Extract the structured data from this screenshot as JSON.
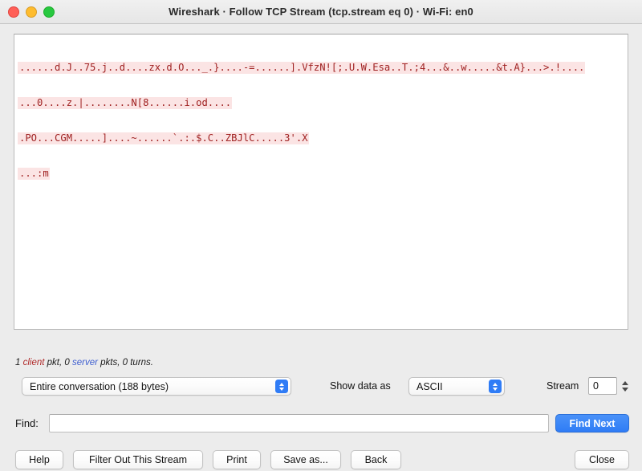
{
  "window": {
    "title": "Wireshark · Follow TCP Stream (tcp.stream eq 0) · Wi-Fi: en0",
    "traffic_lights": {
      "close": "close-button-red",
      "minimize": "minimize-button-yellow",
      "maximize": "maximize-button-green"
    },
    "colors": {
      "close": "#ff5f57",
      "minimize": "#febc2e",
      "maximize": "#28c840",
      "accent": "#2f7cf6",
      "stream_text": "#a02222",
      "stream_highlight": "#fbe4e4",
      "client": "#b02a2a",
      "server": "#3f5fd0",
      "window_bg": "#ececec"
    }
  },
  "stream": {
    "lines": [
      "......d.J..75.j..d....zx.d.O..._.}....-=......].VfzN![;.U.W.Esa..T.;4...&..w.....&t.A}...>.!....",
      "...0....z.|........N[8......i.od....",
      ".PO...CGM.....]....~......`.:.$.C..ZBJlC.....3'.X",
      "...:m"
    ]
  },
  "status": {
    "client_count": "1",
    "client_word": "client",
    "client_suffix": " pkt, ",
    "server_count": "0",
    "server_word": "server",
    "server_suffix": " pkts, 0 turns."
  },
  "controls": {
    "conversation": {
      "label": "Entire conversation (188 bytes)",
      "icon": "chevron-updown-icon"
    },
    "show_data_as": {
      "label": "Show data as",
      "value": "ASCII",
      "icon": "chevron-updown-icon"
    },
    "stream": {
      "label": "Stream",
      "value": "0",
      "icon": "stepper-icon"
    }
  },
  "find": {
    "label": "Find:",
    "value": "",
    "placeholder": "",
    "find_next_label": "Find Next"
  },
  "buttons": {
    "help": "Help",
    "filter_out": "Filter Out This Stream",
    "print": "Print",
    "save_as": "Save as...",
    "back": "Back",
    "close": "Close"
  }
}
